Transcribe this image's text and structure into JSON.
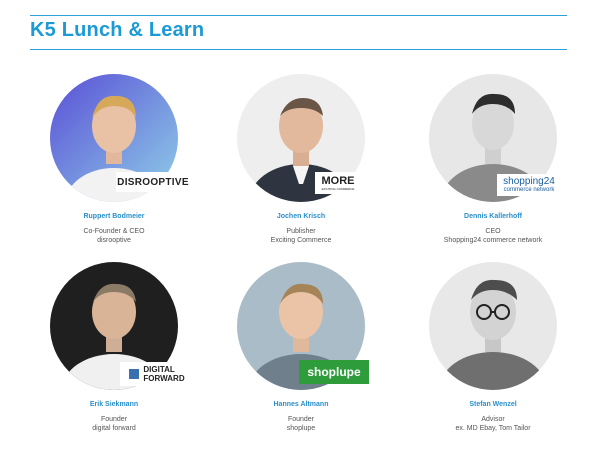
{
  "page": {
    "title": "K5 Lunch & Learn"
  },
  "speakers": [
    {
      "name": "Ruppert Bodmeier",
      "role": "Co-Founder & CEO",
      "org": "disrooptive",
      "logo_text": "DISROOPTIVE",
      "bg": "#6c63d8"
    },
    {
      "name": "Jochen Krisch",
      "role": "Publisher",
      "org": "Exciting Commerce",
      "logo_text": "MORE",
      "logo_sub": "EXCITING COMMERCE",
      "bg": "#eeeeee"
    },
    {
      "name": "Dennis Kallerhoff",
      "role": "CEO",
      "org": "Shopping24 commerce network",
      "logo_text": "shopping24",
      "logo_sub": "commerce network",
      "bg": "#e6e6e6"
    },
    {
      "name": "Erik Siekmann",
      "role": "Founder",
      "org": "digital forward",
      "logo_text": "DIGITAL",
      "logo_sub": "FORWARD",
      "bg": "#1f1f1f"
    },
    {
      "name": "Hannes Altmann",
      "role": "Founder",
      "org": "shoplupe",
      "logo_text": "shoplupe",
      "bg": "#9fb4c0"
    },
    {
      "name": "Stefan Wenzel",
      "role": "Advisor",
      "org": "ex. MD Ebay, Tom Tailor",
      "bg": "#e8e8e8"
    }
  ]
}
